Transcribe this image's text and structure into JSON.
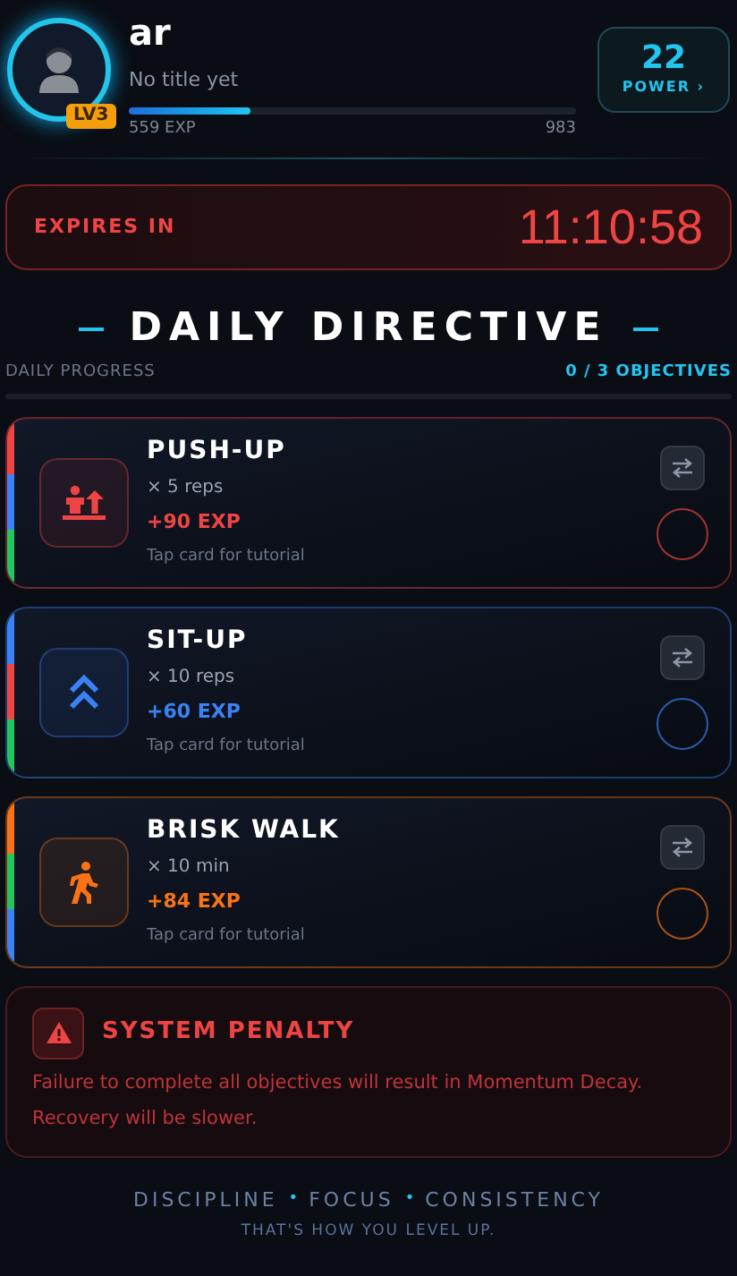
{
  "profile": {
    "name": "ar",
    "title": "No title yet",
    "level_badge": "LV3",
    "exp": "559 EXP",
    "exp_max": "983",
    "level": 0.27
  },
  "power": {
    "value": "22",
    "label": "POWER",
    "chevron": "›"
  },
  "timer": {
    "label": "EXPIRES IN",
    "value": "11:10:58"
  },
  "heading": {
    "title": "DAILY DIRECTIVE"
  },
  "progress": {
    "label": "DAILY PROGRESS",
    "count": "0 / 3 OBJECTIVES",
    "level": 0
  },
  "objectives": [
    {
      "name": "PUSH-UP",
      "amount": "× 5 reps",
      "reward": "+90 EXP",
      "hint": "Tap card for tutorial",
      "kind": "pushup",
      "color": "#ef4444",
      "stripe": [
        {
          "color": "#ef4444"
        },
        {
          "color": "#3b82f6"
        },
        {
          "color": "#22c55e"
        }
      ],
      "checked": false
    },
    {
      "name": "SIT-UP",
      "amount": "× 10 reps",
      "reward": "+60 EXP",
      "hint": "Tap card for tutorial",
      "kind": "situp",
      "color": "#3b82f6",
      "stripe": [
        {
          "color": "#3b82f6"
        },
        {
          "color": "#ef4444"
        },
        {
          "color": "#22c55e"
        }
      ],
      "checked": false
    },
    {
      "name": "BRISK WALK",
      "amount": "× 10 min",
      "reward": "+84 EXP",
      "hint": "Tap card for tutorial",
      "kind": "walk",
      "color": "#f97316",
      "stripe": [
        {
          "color": "#f97316"
        },
        {
          "color": "#22c55e"
        },
        {
          "color": "#3b82f6"
        }
      ],
      "checked": false
    }
  ],
  "penalty": {
    "title": "SYSTEM PENALTY",
    "text": "Failure to complete all objectives will result in Momentum Decay. Recovery will be slower."
  },
  "footer": {
    "words": [
      "DISCIPLINE",
      "FOCUS",
      "CONSISTENCY"
    ],
    "separator": "•",
    "tagline": "THAT'S HOW YOU LEVEL UP."
  }
}
